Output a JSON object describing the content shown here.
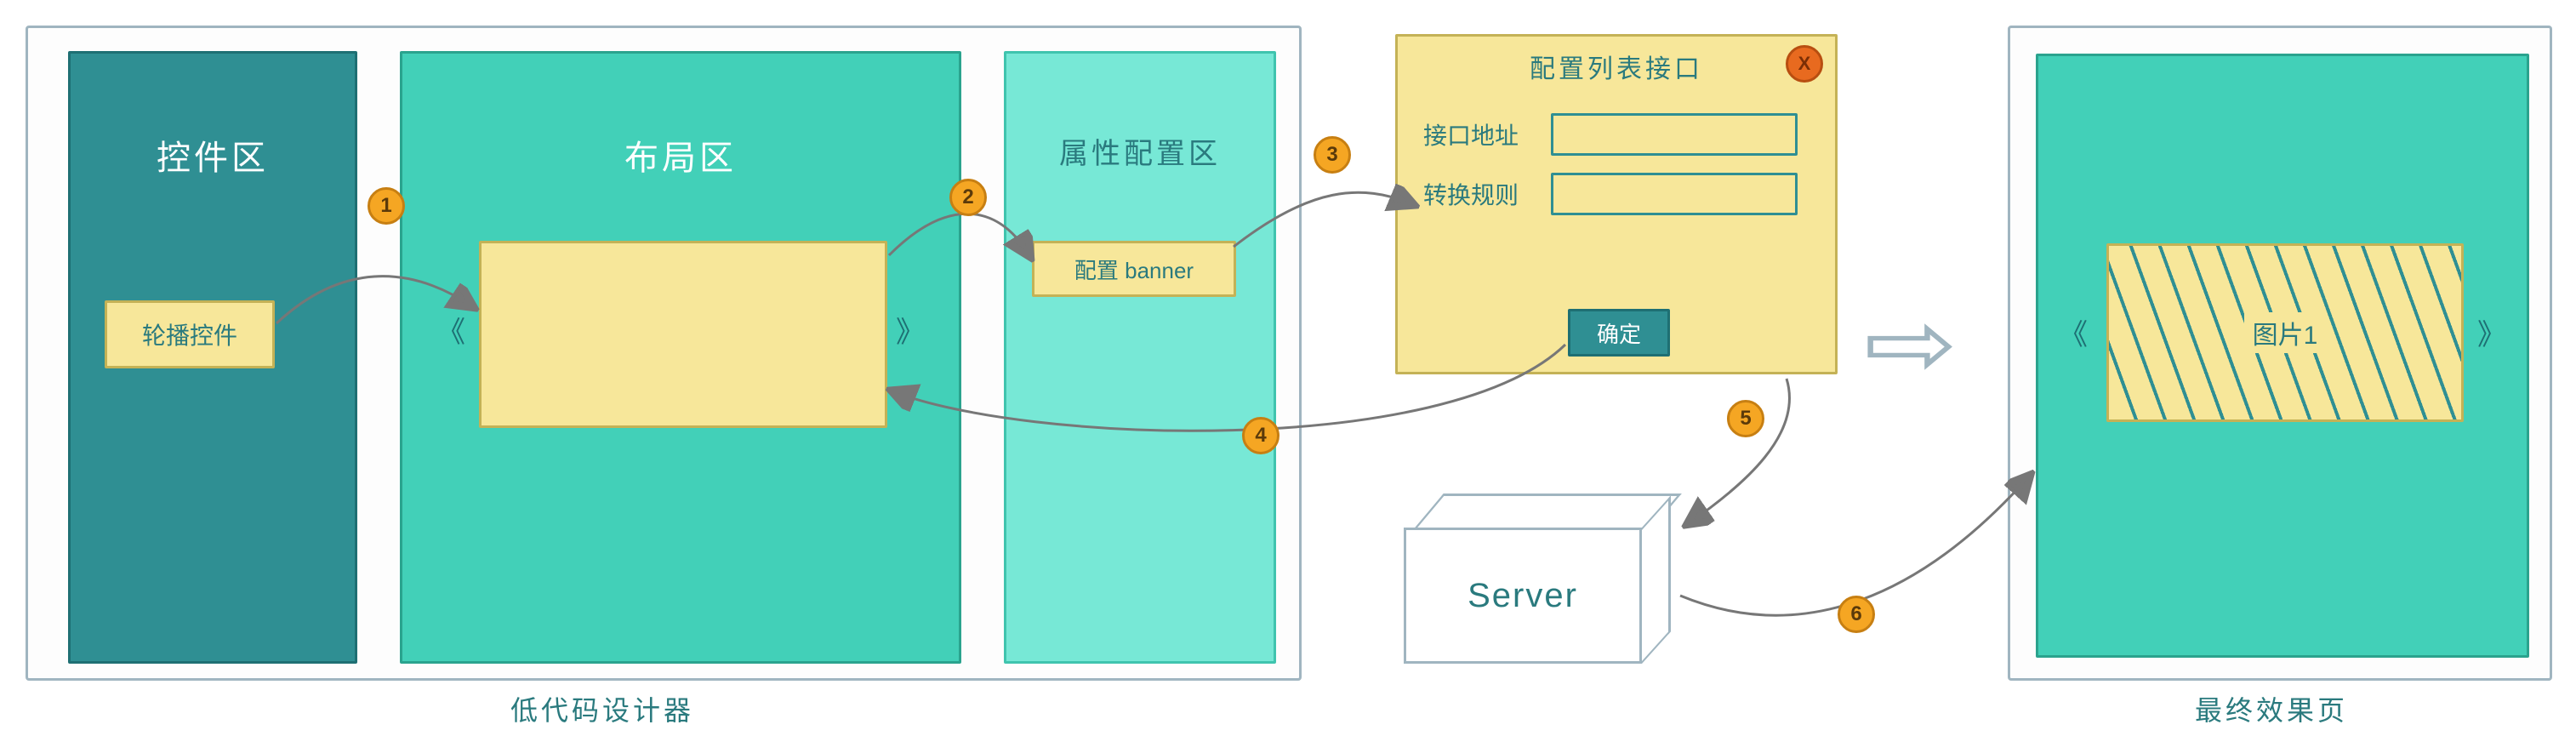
{
  "designer": {
    "caption": "低代码设计器",
    "components_area": {
      "title": "控件区",
      "widget_label": "轮播控件"
    },
    "layout_area": {
      "title": "布局区",
      "prev_glyph": "《",
      "next_glyph": "》"
    },
    "props_area": {
      "title": "属性配置区",
      "config_btn": "配置 banner"
    }
  },
  "dialog": {
    "title": "配置列表接口",
    "close_glyph": "X",
    "field_api": "接口地址",
    "field_rule": "转换规则",
    "confirm": "确定"
  },
  "server": {
    "label": "Server"
  },
  "result": {
    "caption": "最终效果页",
    "image_label": "图片1",
    "prev_glyph": "《",
    "next_glyph": "》"
  },
  "steps": {
    "s1": "1",
    "s2": "2",
    "s3": "3",
    "s4": "4",
    "s5": "5",
    "s6": "6"
  },
  "big_arrow": "⇨"
}
